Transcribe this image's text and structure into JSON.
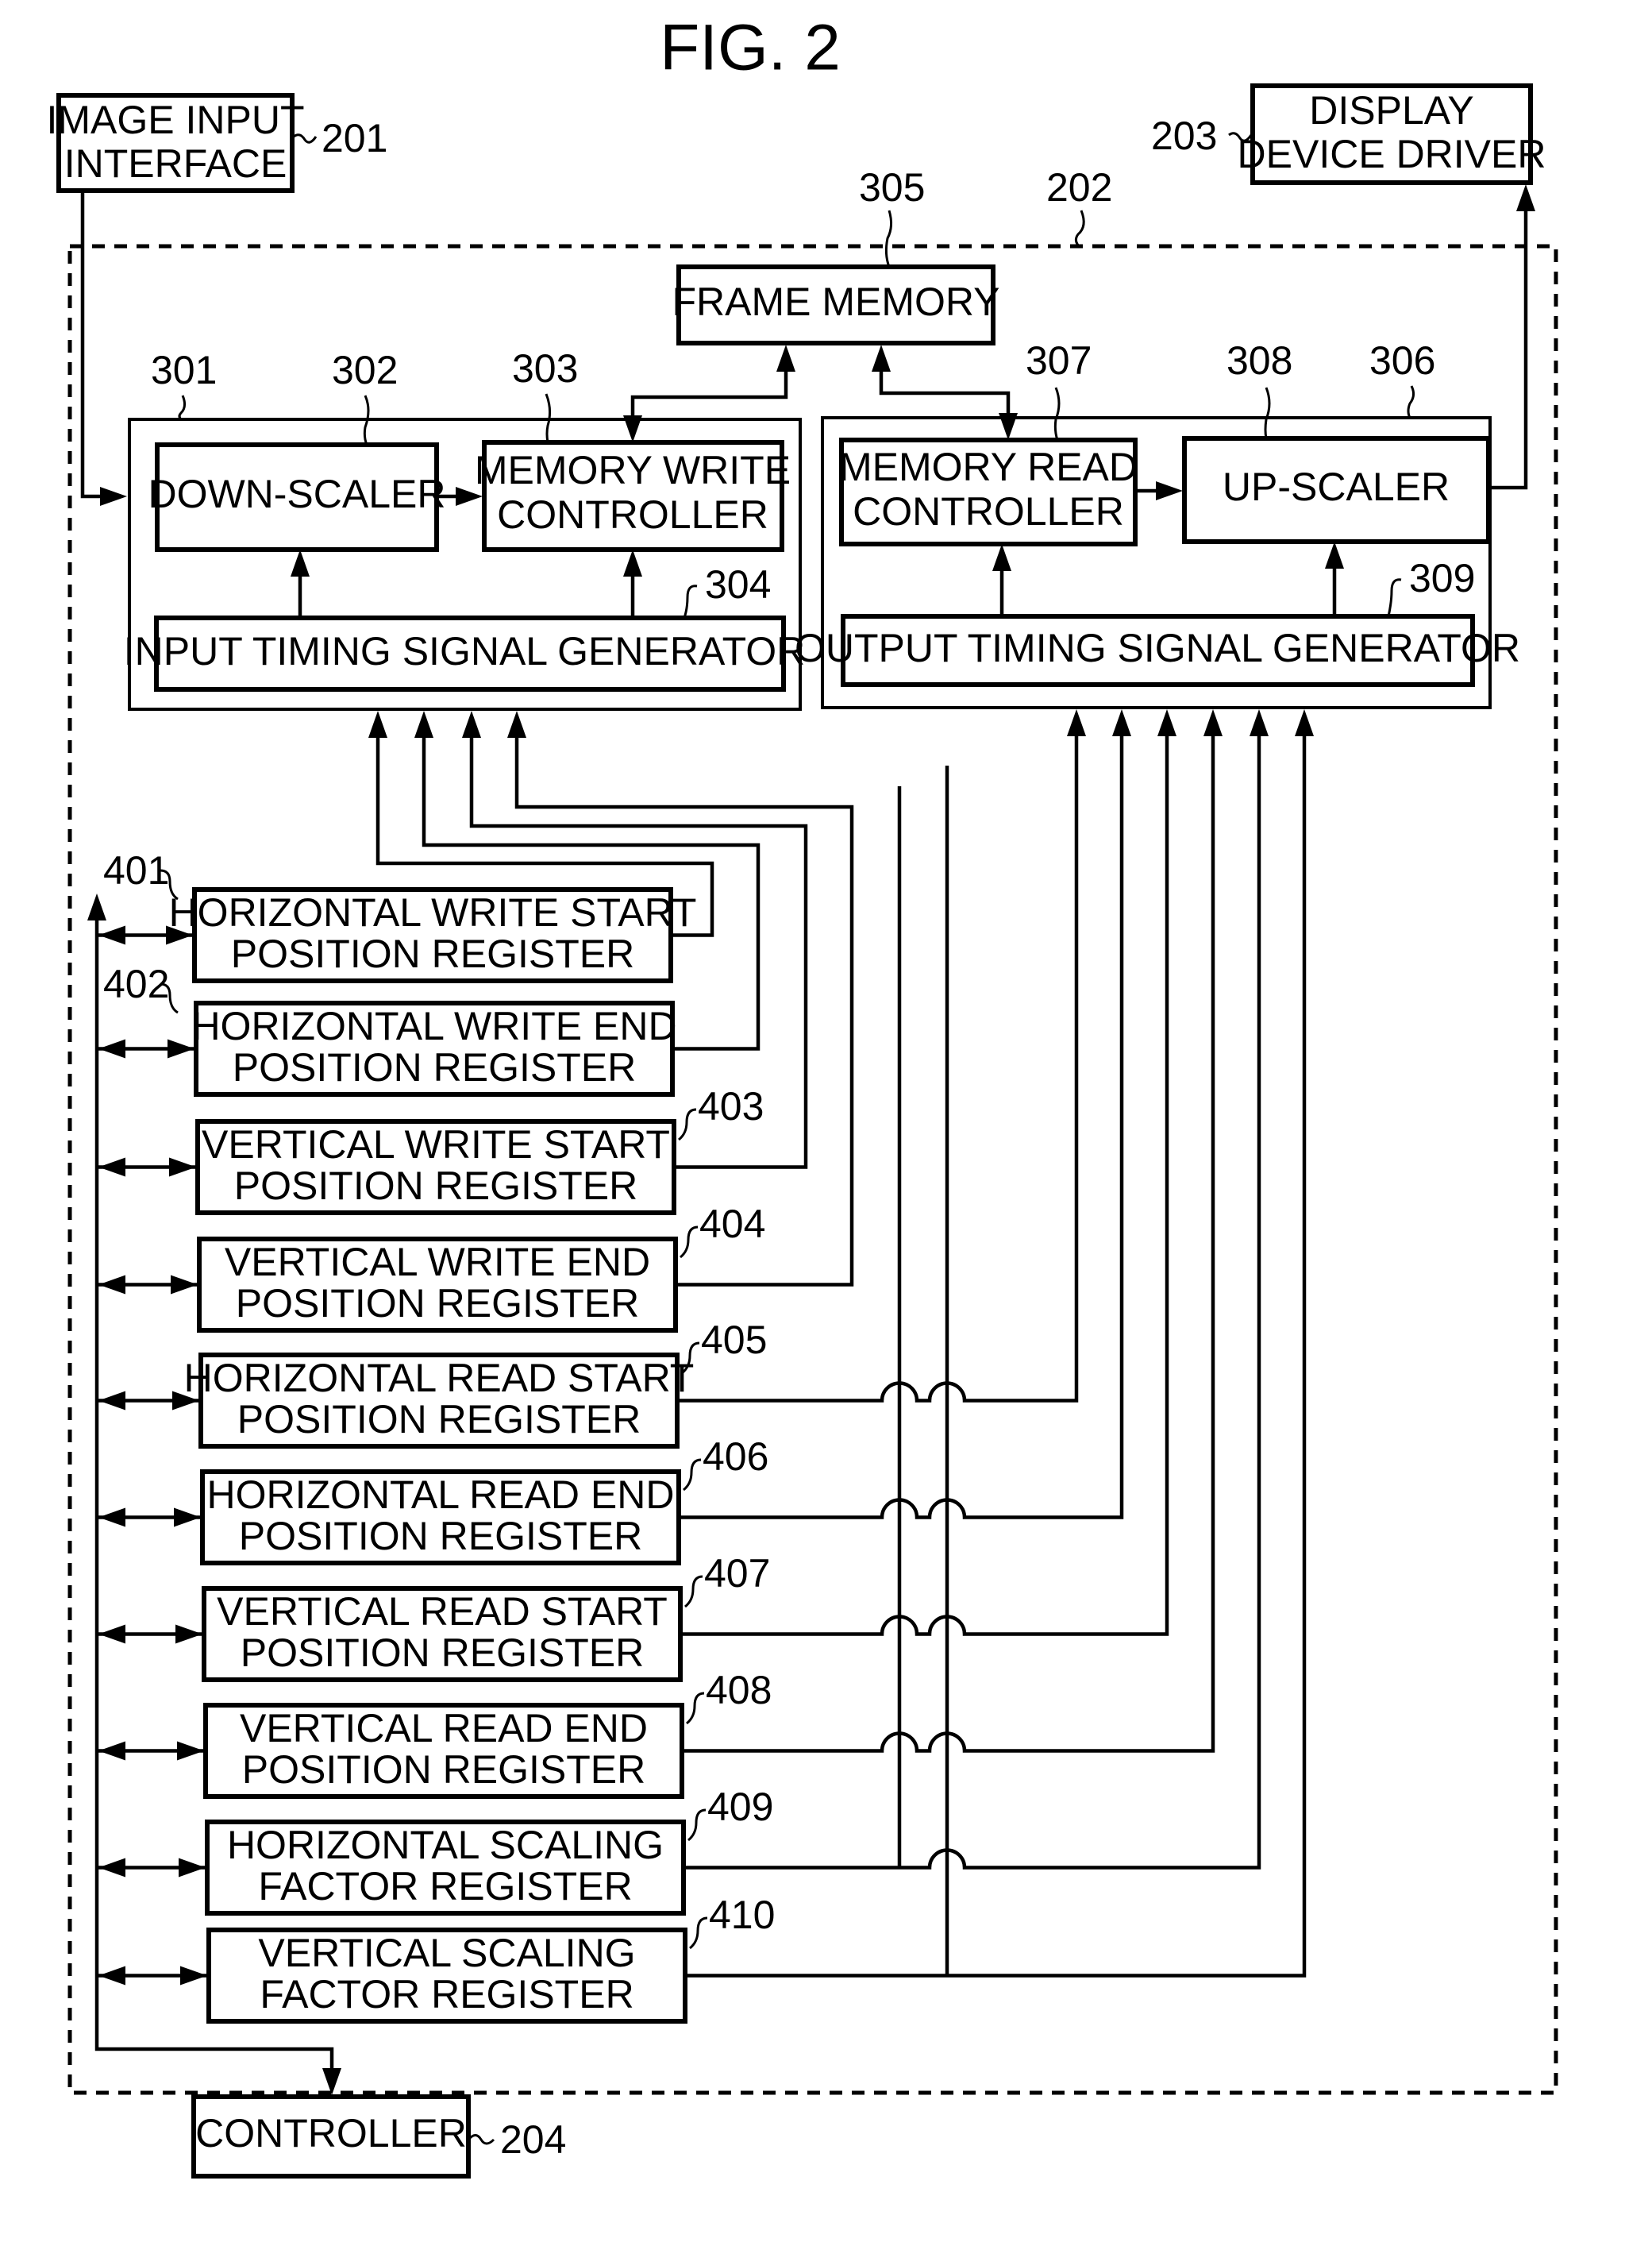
{
  "figure": {
    "title": "FIG. 2"
  },
  "colors": {
    "ink": "#000000",
    "paper": "#ffffff"
  },
  "external": {
    "image_input_interface": {
      "ref": "201",
      "lines": [
        "IMAGE INPUT",
        "INTERFACE"
      ]
    },
    "display_device_driver": {
      "ref": "203",
      "lines": [
        "DISPLAY",
        "DEVICE DRIVER"
      ]
    },
    "controller": {
      "ref": "204",
      "lines": [
        "CONTROLLER"
      ]
    }
  },
  "scaler_unit": {
    "ref": "202"
  },
  "frame_memory": {
    "ref": "305",
    "lines": [
      "FRAME MEMORY"
    ]
  },
  "input_block": {
    "ref": "301",
    "down_scaler": {
      "ref": "302",
      "lines": [
        "DOWN-SCALER"
      ]
    },
    "memory_write_controller": {
      "ref": "303",
      "lines": [
        "MEMORY WRITE",
        "CONTROLLER"
      ]
    },
    "input_timing_signal_generator": {
      "ref": "304",
      "lines": [
        "INPUT TIMING SIGNAL GENERATOR"
      ]
    }
  },
  "output_block": {
    "ref": "306",
    "memory_read_controller": {
      "ref": "307",
      "lines": [
        "MEMORY READ",
        "CONTROLLER"
      ]
    },
    "up_scaler": {
      "ref": "308",
      "lines": [
        "UP-SCALER"
      ]
    },
    "output_timing_signal_generator": {
      "ref": "309",
      "lines": [
        "OUTPUT TIMING SIGNAL GENERATOR"
      ]
    }
  },
  "registers": [
    {
      "ref": "401",
      "lines": [
        "HORIZONTAL WRITE START",
        "POSITION REGISTER"
      ],
      "target": "input",
      "slot": 0
    },
    {
      "ref": "402",
      "lines": [
        "HORIZONTAL WRITE END",
        "POSITION REGISTER"
      ],
      "target": "input",
      "slot": 1
    },
    {
      "ref": "403",
      "lines": [
        "VERTICAL WRITE START",
        "POSITION REGISTER"
      ],
      "target": "input",
      "slot": 2
    },
    {
      "ref": "404",
      "lines": [
        "VERTICAL WRITE END",
        "POSITION REGISTER"
      ],
      "target": "input",
      "slot": 3
    },
    {
      "ref": "405",
      "lines": [
        "HORIZONTAL READ START",
        "POSITION REGISTER"
      ],
      "target": "output",
      "slot": 0
    },
    {
      "ref": "406",
      "lines": [
        "HORIZONTAL READ END",
        "POSITION REGISTER"
      ],
      "target": "output",
      "slot": 1
    },
    {
      "ref": "407",
      "lines": [
        "VERTICAL READ START",
        "POSITION REGISTER"
      ],
      "target": "output",
      "slot": 2
    },
    {
      "ref": "408",
      "lines": [
        "VERTICAL READ END",
        "POSITION REGISTER"
      ],
      "target": "output",
      "slot": 3
    },
    {
      "ref": "409",
      "lines": [
        "HORIZONTAL SCALING",
        "FACTOR REGISTER"
      ],
      "target": "both",
      "slot": 4
    },
    {
      "ref": "410",
      "lines": [
        "VERTICAL SCALING",
        "FACTOR REGISTER"
      ],
      "target": "both",
      "slot": 5
    }
  ]
}
